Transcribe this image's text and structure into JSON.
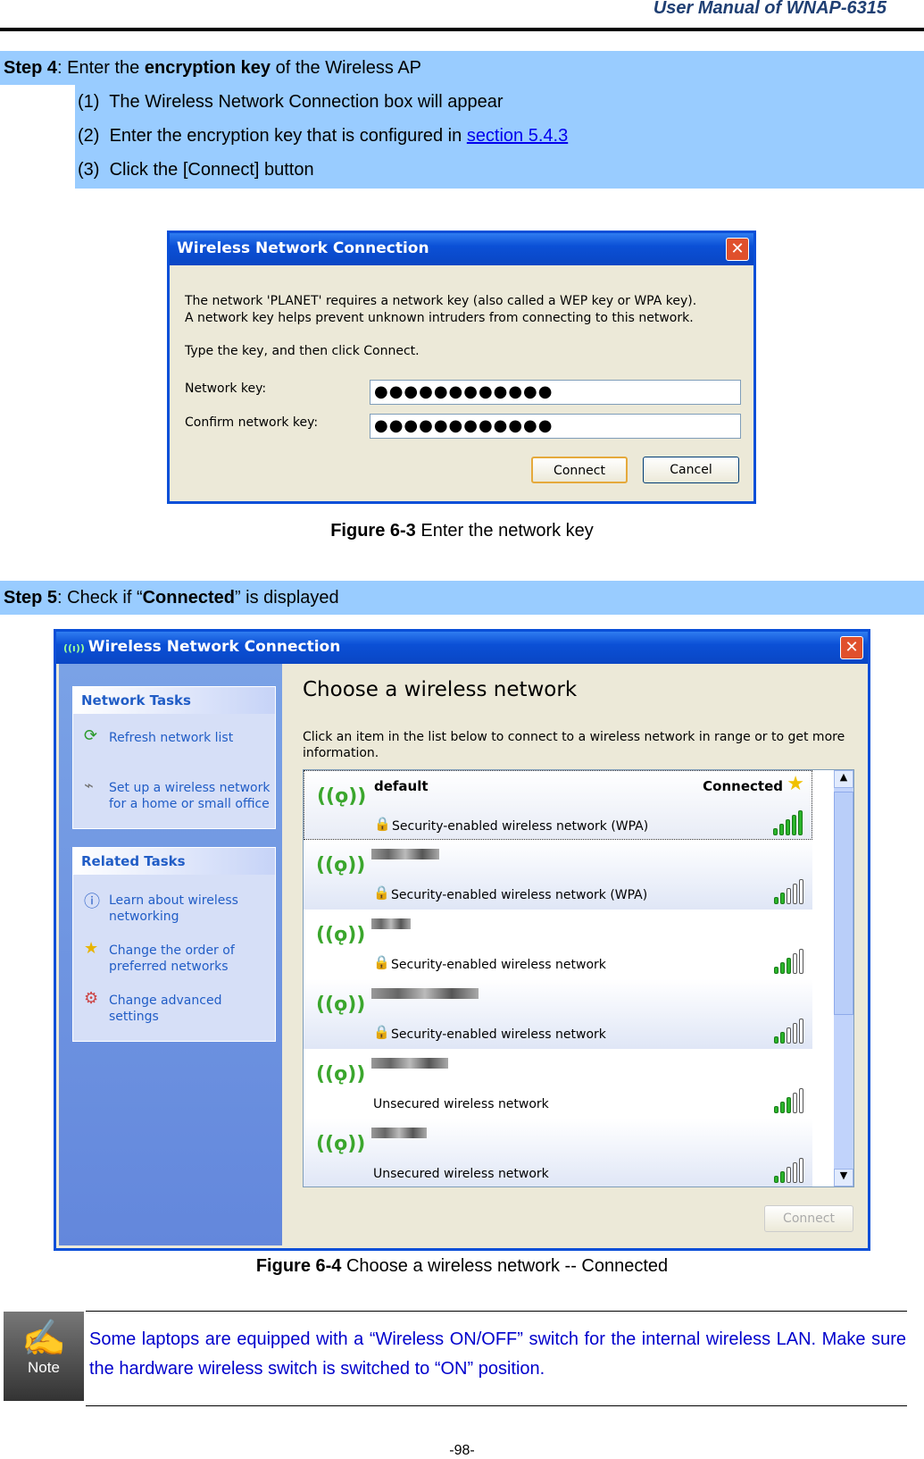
{
  "header": {
    "title": "User  Manual  of  WNAP-6315"
  },
  "step4": {
    "label": "Step 4",
    "t1": ": Enter the ",
    "bold": "encryption key",
    "t2": " of the Wireless AP",
    "items": [
      {
        "num": "(1)",
        "text": "The Wireless Network Connection box will appear"
      },
      {
        "num": "(2)",
        "text": "Enter the encryption key that is configured in ",
        "link": "section 5.4.3"
      },
      {
        "num": "(3)",
        "text": "Click the [Connect] button"
      }
    ]
  },
  "dialog1": {
    "title": "Wireless Network Connection",
    "line1": "The network 'PLANET' requires a network key (also called a WEP key or WPA key).",
    "line2": "A network key helps prevent unknown intruders from connecting to this network.",
    "line3": "Type the key, and then click Connect.",
    "key_label": "Network key:",
    "confirm_label": "Confirm network key:",
    "key_value": "●●●●●●●●●●●●",
    "confirm_value": "●●●●●●●●●●●●",
    "connect": "Connect",
    "cancel": "Cancel"
  },
  "fig3": {
    "num": "Figure 6-3",
    "text": " Enter the network key"
  },
  "step5": {
    "label": "Step 5",
    "t1": ": Check if “",
    "bold": "Connected",
    "t2": "” is displayed"
  },
  "dialog2": {
    "title": "Wireless Network Connection",
    "network_tasks": "Network Tasks",
    "refresh": "Refresh network list",
    "setup1": "Set up a wireless network",
    "setup2": "for a home or small office",
    "related_tasks": "Related Tasks",
    "learn1": "Learn about wireless",
    "learn2": "networking",
    "order1": "Change the order of",
    "order2": "preferred networks",
    "adv1": "Change advanced",
    "adv2": "settings",
    "heading": "Choose a wireless network",
    "desc1": "Click an item in the list below to connect to a wireless network in range or to get more",
    "desc2": "information.",
    "connect": "Connect",
    "networks": [
      {
        "name": "default",
        "status": "Connected",
        "security": "Security-enabled wireless network (WPA)",
        "signal": 5,
        "secured": true
      },
      {
        "name": "",
        "security": "Security-enabled wireless network (WPA)",
        "signal": 2,
        "secured": true
      },
      {
        "name": "",
        "security": "Security-enabled wireless network",
        "signal": 3,
        "secured": true
      },
      {
        "name": "",
        "security": "Security-enabled wireless network",
        "signal": 2,
        "secured": true
      },
      {
        "name": "",
        "security": "Unsecured wireless network",
        "signal": 3,
        "secured": false
      },
      {
        "name": "",
        "security": "Unsecured wireless network",
        "signal": 2,
        "secured": false
      }
    ]
  },
  "fig4": {
    "num": "Figure 6-4",
    "text": " Choose a wireless network -- Connected"
  },
  "note": {
    "icon_label": "Note",
    "text": "Some laptops are equipped with a “Wireless ON/OFF” switch for the internal wireless LAN. Make sure the hardware wireless switch is switched to “ON” position."
  },
  "footer": {
    "page": "-98-"
  }
}
